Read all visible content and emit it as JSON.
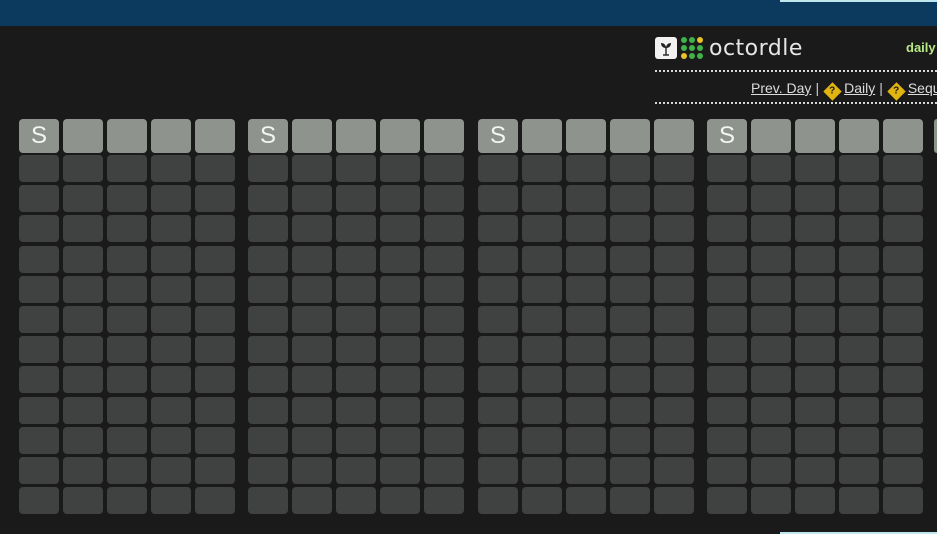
{
  "brand": {
    "name": "octordle",
    "mode_label": "daily",
    "dot_colors": [
      "#3fb24a",
      "#3fb24a",
      "#e8c22a",
      "#3fb24a",
      "#3fb24a",
      "#3fb24a",
      "#e8c22a",
      "#3fb24a",
      "#3fb24a"
    ]
  },
  "nav": {
    "prev_day": "Prev. Day",
    "daily": "Daily",
    "sequence": "Seque",
    "separator": "|",
    "icon_glyph": "?"
  },
  "colors": {
    "topbar": "#0b3a5e",
    "active_tile": "#8f938e",
    "empty_tile": "#3f4240",
    "background": "#1a1a1a"
  },
  "boards": [
    {
      "current_guess": [
        "S",
        "",
        "",
        "",
        ""
      ]
    },
    {
      "current_guess": [
        "S",
        "",
        "",
        "",
        ""
      ]
    },
    {
      "current_guess": [
        "S",
        "",
        "",
        "",
        ""
      ]
    },
    {
      "current_guess": [
        "S",
        "",
        "",
        "",
        ""
      ]
    }
  ]
}
